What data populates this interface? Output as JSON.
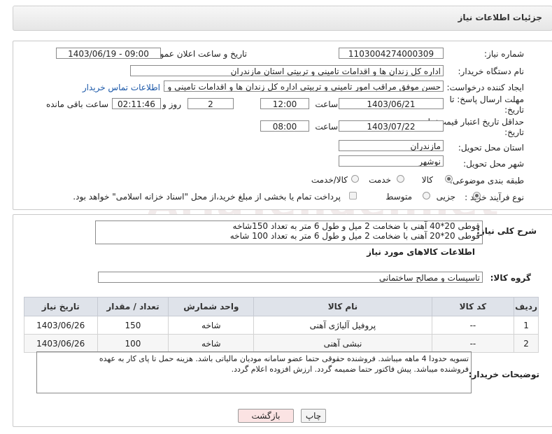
{
  "header": {
    "title": "جزئیات اطلاعات نیاز"
  },
  "form": {
    "need_number": {
      "label": "شماره نیاز:",
      "value": "1103004274000309"
    },
    "announce": {
      "label": "تاریخ و ساعت اعلان عمومی:",
      "value": "1403/06/19 - 09:00"
    },
    "buyer_org": {
      "label": "نام دستگاه خریدار:",
      "value": "اداره کل زندان ها و اقدامات تامینی و تربیتی استان مازندران"
    },
    "creator": {
      "label": "ایجاد کننده درخواست:",
      "value": "حسن موفق مراقب امور تامینی و تربیتی اداره کل زندان ها و اقدامات تامینی و تر",
      "contact_link": "اطلاعات تماس خریدار"
    },
    "deadline": {
      "label_line1": "مهلت ارسال پاسخ: تا",
      "label_line2": "تاریخ:",
      "date": "1403/06/21",
      "time_label": "ساعت",
      "time": "12:00",
      "days": "2",
      "days_label": "روز و",
      "remaining": "02:11:46",
      "remaining_label": "ساعت باقی مانده"
    },
    "validity": {
      "label_line1": "حداقل تاریخ اعتبار قیمت: تا",
      "label_line2": "تاریخ:",
      "date": "1403/07/22",
      "time_label": "ساعت",
      "time": "08:00"
    },
    "province": {
      "label": "استان محل تحویل:",
      "value": "مازندران"
    },
    "city": {
      "label": "شهر محل تحویل:",
      "value": "نوشهر"
    },
    "category": {
      "label": "طبقه بندی موضوعی:",
      "options": [
        "کالا",
        "خدمت",
        "کالا/خدمت"
      ],
      "selected": "کالا"
    },
    "process": {
      "label": "نوع فرآیند خرید :",
      "options": [
        "جزیی",
        "متوسط"
      ],
      "selected": "جزیی",
      "payment_note": "پرداخت تمام یا بخشی از مبلغ خرید،از محل \"اسناد خزانه اسلامی\" خواهد بود."
    }
  },
  "description": {
    "label": "شرح کلی نیاز:",
    "line1": "قوطی 20*40 آهنی با ضخامت 2 میل و طول 6 متر به تعداد 150شاخه",
    "line2": "قوطی 20*20 آهنی با ضخامت 2 میل و طول 6 متر به تعداد 100 شاخه"
  },
  "goods": {
    "section_title": "اطلاعات کالاهای مورد نیاز",
    "group_label": "گروه کالا:",
    "group_value": "تاسیسات و مصالح ساختمانی",
    "columns": [
      "ردیف",
      "کد کالا",
      "نام کالا",
      "واحد شمارش",
      "تعداد / مقدار",
      "تاریخ نیاز"
    ],
    "rows": [
      {
        "row": "1",
        "code": "--",
        "name": "پروفیل آلیاژی آهنی",
        "unit": "شاخه",
        "qty": "150",
        "date": "1403/06/26"
      },
      {
        "row": "2",
        "code": "--",
        "name": "نبشی آهنی",
        "unit": "شاخه",
        "qty": "100",
        "date": "1403/06/26"
      }
    ]
  },
  "buyer_notes": {
    "label": "توضیحات خریدار:",
    "line1": "تسویه حدودا 4 ماهه میباشد. فروشنده حقوقی حتما عضو سامانه مودیان مالیاتی باشد. هزینه حمل تا پای کار به عهده",
    "line2": "فروشنده میباشد. پیش فاکتور حتما ضمیمه گردد. ارزش افزوده اعلام گردد."
  },
  "buttons": {
    "print": "چاپ",
    "back": "بازگشت"
  },
  "watermark": "AriaTender.net",
  "colors": {
    "header_bg": "#eaeaea",
    "link": "#1a57a8",
    "back_button_bg": "#fbe3e3",
    "table_header_bg": "#dfe3ea"
  }
}
